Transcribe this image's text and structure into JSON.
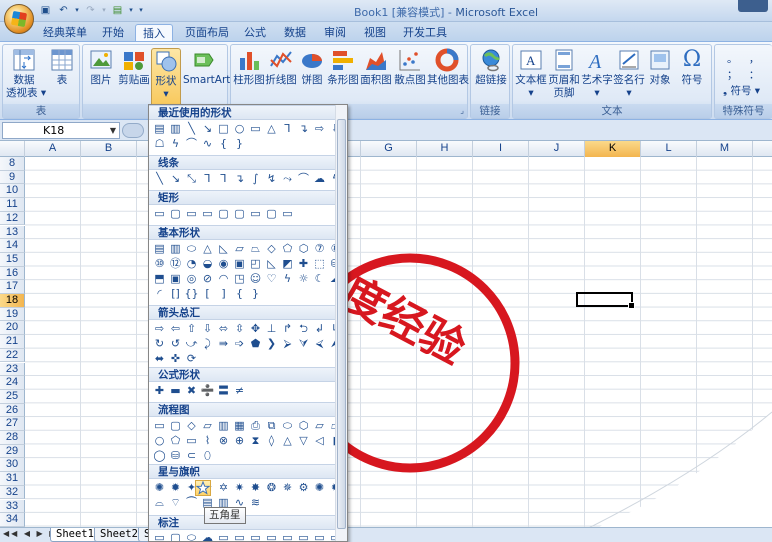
{
  "title": {
    "doc": "Book1  [兼容模式] - ",
    "app": "Microsoft Excel"
  },
  "quick_access": [
    "save-icon",
    "undo-icon",
    "redo-icon",
    "print-preview-icon",
    "customize-icon"
  ],
  "tabs": [
    "经典菜单",
    "开始",
    "插入",
    "页面布局",
    "公式",
    "数据",
    "审阅",
    "视图",
    "开发工具"
  ],
  "active_tab": "插入",
  "ribbon": {
    "tables_group": {
      "label": "表",
      "pivot": "数据\n透视表",
      "pivot_l1": "数据",
      "pivot_l2": "透视表 ▾",
      "table": "表"
    },
    "illustrations": {
      "picture": "图片",
      "clipart": "剪贴画",
      "shapes": "形状",
      "smartart": "SmartArt",
      "shapes_arrow": "▾"
    },
    "charts_group": {
      "column": "柱形图",
      "line": "折线图",
      "pie": "饼图",
      "bar": "条形图",
      "area": "面积图",
      "scatter": "散点图",
      "other": "其他图表"
    },
    "links_group": {
      "label": "链接",
      "hyperlink": "超链接"
    },
    "text_group": {
      "label": "文本",
      "textbox": "文本框",
      "header_l1": "页眉和",
      "header_l2": "页脚",
      "wordart": "艺术字",
      "signature": "签名行",
      "object": "对象",
      "symbol": "符号"
    },
    "special_group": {
      "label": "特殊符号",
      "symbol_btn": "符号",
      "dots": "。 ，",
      "dots2": "； ："
    }
  },
  "name_box": "K18",
  "columns": [
    "A",
    "B",
    "C",
    "D",
    "E",
    "F",
    "G",
    "H",
    "I",
    "J",
    "K",
    "L",
    "M",
    "N"
  ],
  "selected_column": "K",
  "rows": [
    "8",
    "9",
    "10",
    "11",
    "12",
    "13",
    "14",
    "15",
    "16",
    "17",
    "18",
    "19",
    "20",
    "21",
    "22",
    "23",
    "24",
    "25",
    "26",
    "27",
    "28",
    "29",
    "30",
    "31",
    "32",
    "33",
    "34"
  ],
  "selected_row": "18",
  "stamp_text": "度经验",
  "sheets": [
    "Sheet1",
    "Sheet2",
    "S"
  ],
  "shapes_menu": {
    "recent": "最近使用的形状",
    "lines": "线条",
    "rect": "矩形",
    "basic": "基本形状",
    "arrows": "箭头总汇",
    "equation": "公式形状",
    "flowchart": "流程图",
    "stars": "星与旗帜",
    "callouts": "标注"
  },
  "tooltip": "五角星",
  "colors": {
    "stamp": "#d7171f",
    "ribbon": "#dce7f5",
    "selected": "#f8c85b"
  }
}
